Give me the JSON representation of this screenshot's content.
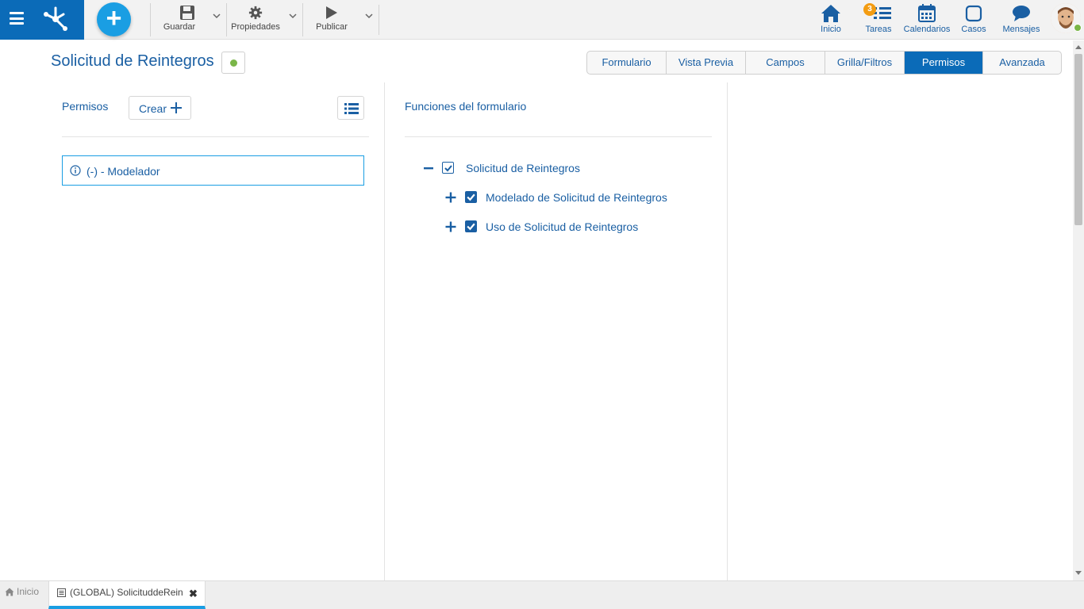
{
  "app": {
    "logo_icon": "deyel-logo-icon",
    "menu_icon": "hamburger-icon",
    "brand_color": "#0b6bb8",
    "accent_color": "#1a9ee3"
  },
  "toolbar": {
    "add_icon": "plus-icon",
    "guardar_label": "Guardar",
    "propiedades_label": "Propiedades",
    "publicar_label": "Publicar"
  },
  "nav": {
    "inicio_label": "Inicio",
    "tareas_label": "Tareas",
    "tareas_badge": "3",
    "calendarios_label": "Calendarios",
    "casos_label": "Casos",
    "mensajes_label": "Mensajes"
  },
  "header": {
    "title": "Solicitud de Reintegros",
    "status_color": "#7ab648"
  },
  "tabs": [
    {
      "label": "Formulario",
      "active": false
    },
    {
      "label": "Vista Previa",
      "active": false
    },
    {
      "label": "Campos",
      "active": false
    },
    {
      "label": "Grilla/Filtros",
      "active": false
    },
    {
      "label": "Permisos",
      "active": true
    },
    {
      "label": "Avanzada",
      "active": false
    }
  ],
  "permisos": {
    "label": "Permisos",
    "crear_label": "Crear",
    "items": [
      {
        "label": "(-) - Modelador"
      }
    ]
  },
  "funciones": {
    "label": "Funciones del formulario",
    "tree": [
      {
        "label": "Solicitud de Reintegros",
        "toggle": "collapse",
        "checked": true
      },
      {
        "label": "Modelado de Solicitud de Reintegros",
        "toggle": "expand",
        "checked": true
      },
      {
        "label": "Uso de Solicitud de Reintegros",
        "toggle": "expand",
        "checked": true
      }
    ]
  },
  "bottom_tabs": {
    "home_label": "Inicio",
    "active_label": "(GLOBAL) SolicituddeRein"
  }
}
